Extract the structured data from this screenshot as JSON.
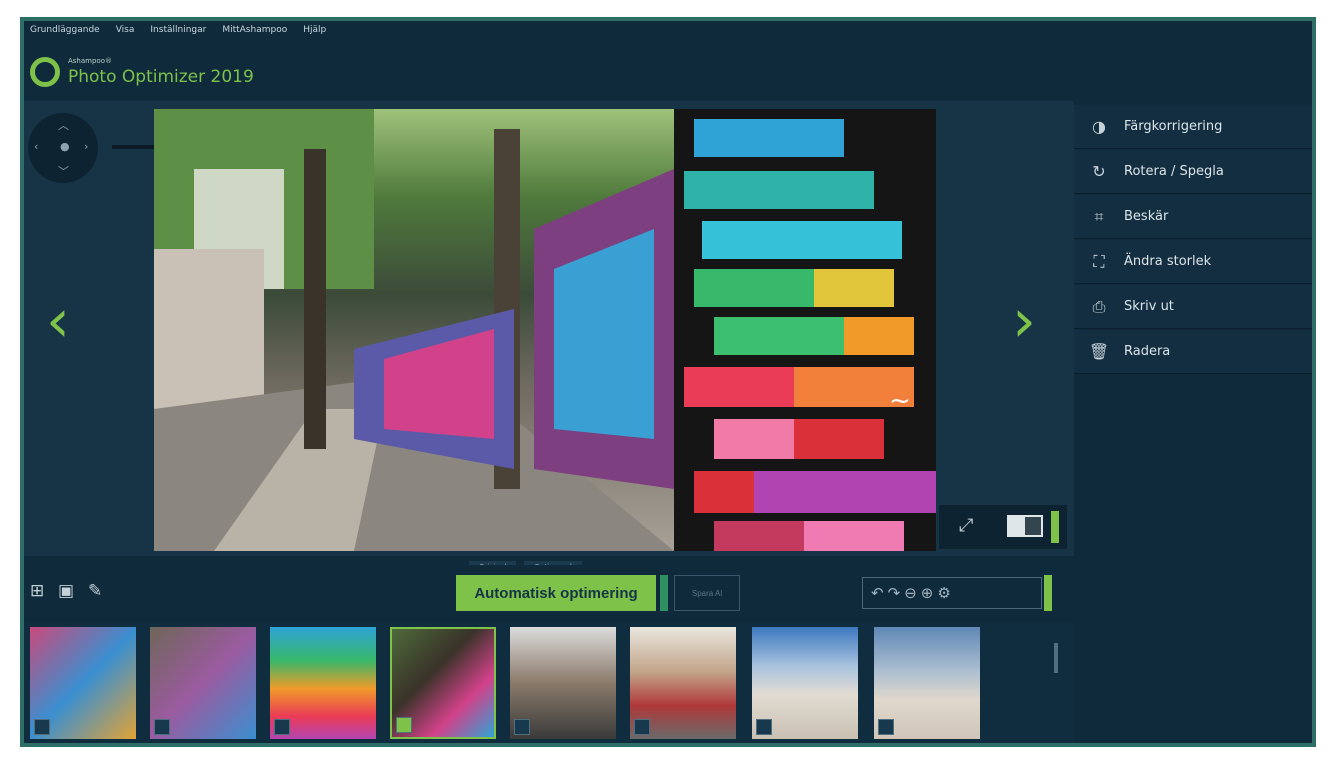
{
  "menu": [
    "Grundläggande",
    "Visa",
    "Inställningar",
    "MittAshampoo",
    "Hjälp"
  ],
  "brand": {
    "company": "Ashampoo®",
    "title": "Photo Optimizer 2019"
  },
  "viewer": {
    "compare_original": "Original",
    "compare_optimized": "Optimerad",
    "icons": {
      "prev": "chevron-left-icon",
      "next": "chevron-right-icon",
      "expand": "expand-icon",
      "split": "split-view-icon",
      "nav": "pan-navigator-icon"
    }
  },
  "toolbar": {
    "auto_optimize": "Automatisk optimering",
    "save_all": "Spara Al"
  },
  "sidebar": {
    "items": [
      {
        "label": "Färgkorrigering",
        "icon": "contrast-icon"
      },
      {
        "label": "Rotera / Spegla",
        "icon": "rotate-icon"
      },
      {
        "label": "Beskär",
        "icon": "crop-icon"
      },
      {
        "label": "Ändra storlek",
        "icon": "resize-icon"
      },
      {
        "label": "Skriv ut",
        "icon": "printer-icon"
      },
      {
        "label": "Radera",
        "icon": "trash-icon"
      }
    ]
  },
  "thumbnails": {
    "count": 8,
    "selected": 4,
    "colors": [
      "#b84a72",
      "#7a6b55",
      "#e16a3a",
      "#4d6a3a",
      "#8a7a6a",
      "#c2a58a",
      "#6a8fb8",
      "#8aa0b6"
    ]
  },
  "colors": {
    "accent": "#7ec24a",
    "frame": "#2f6e66",
    "panel": "#0f2a3b"
  }
}
